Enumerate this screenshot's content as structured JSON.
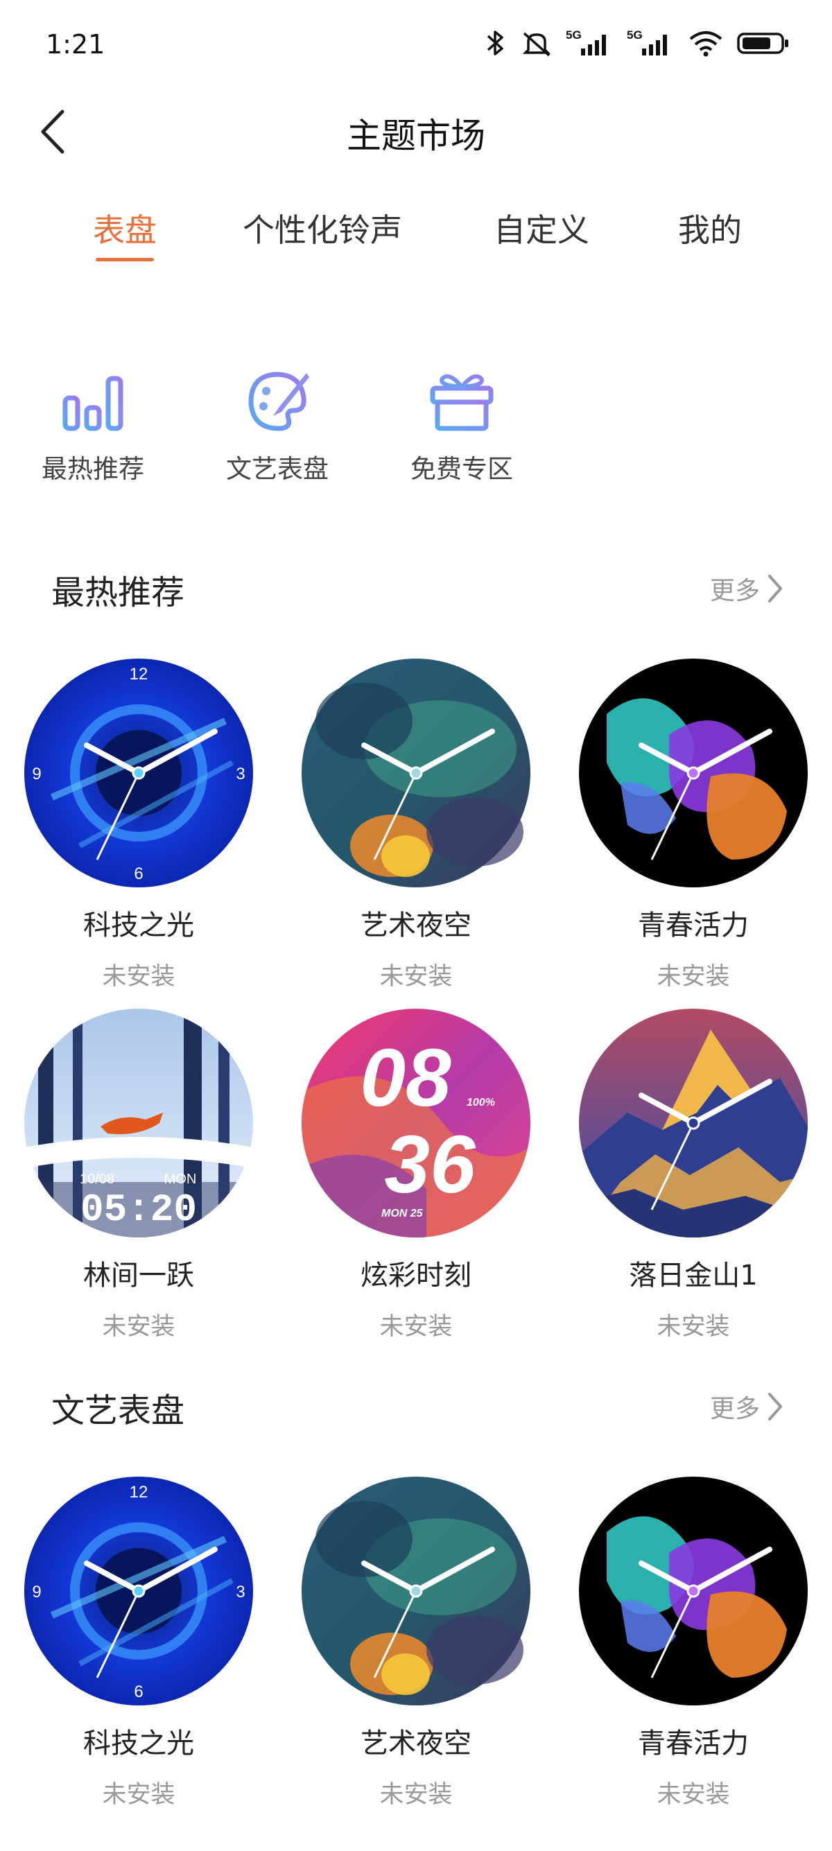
{
  "status_bar": {
    "time": "1:21",
    "net1": "5G",
    "net2": "5G"
  },
  "nav": {
    "title": "主题市场"
  },
  "tabs": [
    {
      "label": "表盘",
      "active": true
    },
    {
      "label": "个性化铃声",
      "active": false
    },
    {
      "label": "自定义",
      "active": false
    },
    {
      "label": "我的",
      "active": false
    }
  ],
  "categories": [
    {
      "label": "最热推荐",
      "icon": "bar-chart-icon"
    },
    {
      "label": "文艺表盘",
      "icon": "palette-icon"
    },
    {
      "label": "免费专区",
      "icon": "gift-icon"
    }
  ],
  "sections": [
    {
      "title": "最热推荐",
      "more": "更多",
      "items": [
        {
          "name": "科技之光",
          "status": "未安装"
        },
        {
          "name": "艺术夜空",
          "status": "未安装"
        },
        {
          "name": "青春活力",
          "status": "未安装"
        },
        {
          "name": "林间一跃",
          "status": "未安装",
          "date": "10/08",
          "day": "MON",
          "time": "05:20"
        },
        {
          "name": "炫彩时刻",
          "status": "未安装",
          "hour": "08",
          "minute": "36",
          "battery": "100%",
          "date": "MON 25"
        },
        {
          "name": "落日金山1",
          "status": "未安装"
        }
      ]
    },
    {
      "title": "文艺表盘",
      "more": "更多",
      "items": [
        {
          "name": "科技之光",
          "status": "未安装"
        },
        {
          "name": "艺术夜空",
          "status": "未安装"
        },
        {
          "name": "青春活力",
          "status": "未安装"
        }
      ]
    }
  ],
  "dial_numbers": {
    "top": "12",
    "right": "3",
    "bottom": "6",
    "left": "9"
  },
  "colors": {
    "accent": "#e8703a",
    "icon_gradient_start": "#5aa8f0",
    "icon_gradient_end": "#9b7cf0"
  }
}
